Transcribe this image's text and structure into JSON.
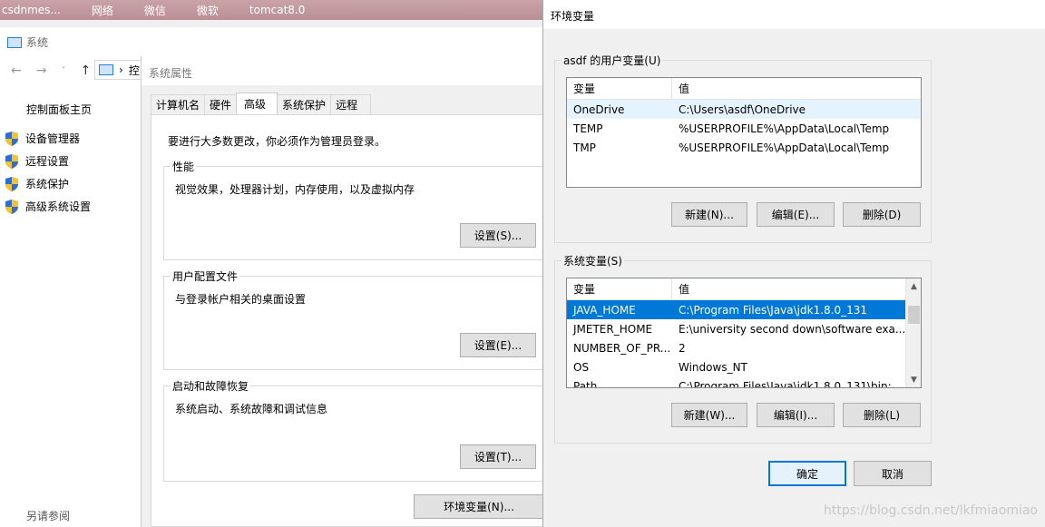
{
  "taskbar": {
    "items": [
      "csdnmes...",
      "网络",
      "微信",
      "微软",
      "tomcat8.0"
    ]
  },
  "system_window": {
    "title": "系统",
    "nav": {
      "back": "←",
      "forward": "→",
      "dropdown": "˅",
      "up": "↑",
      "breadcrumb_sep": "›",
      "crumb": "控"
    },
    "left_panel": {
      "home": "控制面板主页",
      "items": [
        "设备管理器",
        "远程设置",
        "系统保护",
        "高级系统设置"
      ],
      "see_also": "另请参阅"
    }
  },
  "sys_props": {
    "title": "系统属性",
    "tabs": [
      "计算机名",
      "硬件",
      "高级",
      "系统保护",
      "远程"
    ],
    "active_tab": "高级",
    "notice": "要进行大多数更改，你必须作为管理员登录。",
    "groups": [
      {
        "title": "性能",
        "desc": "视觉效果，处理器计划，内存使用，以及虚拟内存",
        "button": "设置(S)..."
      },
      {
        "title": "用户配置文件",
        "desc": "与登录帐户相关的桌面设置",
        "button": "设置(E)..."
      },
      {
        "title": "启动和故障恢复",
        "desc": "系统启动、系统故障和调试信息",
        "button": "设置(T)..."
      }
    ],
    "env_button": "环境变量(N)..."
  },
  "env_dialog": {
    "title": "环境变量",
    "user_vars": {
      "label": "asdf 的用户变量(U)",
      "headers": [
        "变量",
        "值"
      ],
      "rows": [
        [
          "OneDrive",
          "C:\\Users\\asdf\\OneDrive"
        ],
        [
          "TEMP",
          "%USERPROFILE%\\AppData\\Local\\Temp"
        ],
        [
          "TMP",
          "%USERPROFILE%\\AppData\\Local\\Temp"
        ]
      ],
      "buttons": [
        "新建(N)...",
        "编辑(E)...",
        "删除(D)"
      ]
    },
    "sys_vars": {
      "label": "系统变量(S)",
      "headers": [
        "变量",
        "值"
      ],
      "rows": [
        [
          "JAVA_HOME",
          "C:\\Program Files\\Java\\jdk1.8.0_131"
        ],
        [
          "JMETER_HOME",
          "E:\\university second down\\software exa..."
        ],
        [
          "NUMBER_OF_PR...",
          "2"
        ],
        [
          "OS",
          "Windows_NT"
        ],
        [
          "Path",
          "C:\\Program Files\\Java\\jdk1.8.0_131\\bin;..."
        ]
      ],
      "selected_row": "JAVA_HOME",
      "buttons": [
        "新建(W)...",
        "编辑(I)...",
        "删除(L)"
      ]
    },
    "ok": "确定",
    "cancel": "取消"
  },
  "watermark": "https://blog.csdn.net/lkfmiaomiao",
  "colors": {
    "accent": "#0078d7",
    "shield_blue": "#2b6fd6",
    "shield_yellow": "#f6c32b"
  }
}
